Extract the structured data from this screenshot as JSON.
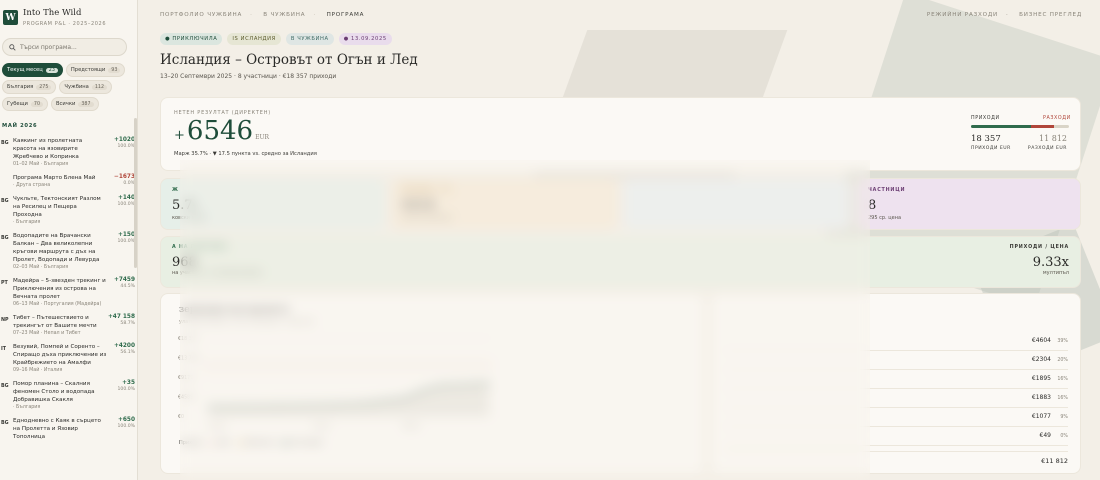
{
  "sidebar": {
    "brand_letter": "W",
    "brand_title": "Into The Wild",
    "brand_sub": "PROGRAM P&L · 2025–2026",
    "search_placeholder": "Търси програма...",
    "filters": [
      {
        "label": "Текущ месец",
        "count": "23",
        "active": true
      },
      {
        "label": "Предстоящи",
        "count": "93",
        "active": false
      },
      {
        "label": "България",
        "count": "275",
        "active": false
      },
      {
        "label": "Чужбина",
        "count": "112",
        "active": false
      },
      {
        "label": "Губещи",
        "count": "70",
        "active": false
      },
      {
        "label": "Всички",
        "count": "387",
        "active": false
      }
    ],
    "month": "МАЙ 2026",
    "programs": [
      {
        "code": "BG",
        "name": "Каякинг из пролетната красота на язовирите Жребчево и Копринка",
        "meta": "01–02 Май · България",
        "net": "+1020",
        "pct": "100.0%",
        "neg": false
      },
      {
        "code": "",
        "name": "Програма Марто Блена Май",
        "meta": "· Друга страна",
        "net": "−1673",
        "pct": "0.0%",
        "neg": true
      },
      {
        "code": "BG",
        "name": "Чукльте, Тектонският Разлом на Ресилец и Пещера Проходна",
        "meta": "· България",
        "net": "+140",
        "pct": "100.0%",
        "neg": false
      },
      {
        "code": "BG",
        "name": "Водопадите на Врачански Балкан – Два великолепни кръгови маршрута с дъх на Пролет, Водопади и Левурда",
        "meta": "02–03 Май · България",
        "net": "+150",
        "pct": "100.0%",
        "neg": false
      },
      {
        "code": "PT",
        "name": "Мадейра – 5-звезден трекинг и Приключения из острова на Вечната пролет",
        "meta": "06–13 Май · Португалия (Мадейра)",
        "net": "+7459",
        "pct": "44.5%",
        "neg": false
      },
      {
        "code": "NP",
        "name": "Тибет – Пътешествието и трекингът от Вашите мечти",
        "meta": "07–23 Май · Непал и Тибет",
        "net": "+47 158",
        "pct": "58.7%",
        "neg": false
      },
      {
        "code": "IT",
        "name": "Везувий, Помпей и Соренто – Спиращо дъха приключение из Крайбрежието на Амалфи",
        "meta": "09–16 Май · Италия",
        "net": "+4200",
        "pct": "56.1%",
        "neg": false
      },
      {
        "code": "BG",
        "name": "Помор планина – Скалния феномен Столо и водопада Добравишка Скакля",
        "meta": "· България",
        "net": "+35",
        "pct": "100.0%",
        "neg": false
      },
      {
        "code": "BG",
        "name": "Еднодневно с Каяк в сърцето на Пролетта и Язовир Тополница",
        "meta": "",
        "net": "+650",
        "pct": "100.0%",
        "neg": false
      }
    ]
  },
  "header": {
    "crumbs": [
      "ПОРТФОЛИО ЧУЖБИНА",
      "В ЧУЖБИНА",
      "ПРОГРАМА"
    ],
    "links": [
      "РЕЖИЙНИ РАЗХОДИ",
      "БИЗНЕС ПРЕГЛЕД"
    ],
    "tags": [
      "ПРИКЛЮЧИЛА",
      "IS ИСЛАНДИЯ",
      "В ЧУЖБИНА",
      "13.09.2025"
    ],
    "title": "Исландия – Островът от Огън и Лед",
    "subtitle": "13–20 Септември 2025 · 8 участници · €18 357 приходи"
  },
  "net": {
    "label": "НЕТЕН РЕЗУЛТАТ (ДИРЕКТЕН)",
    "sign": "+",
    "value": "6546",
    "currency": "EUR",
    "margin": "Марж 35.7% · ▼ 17.5 пункта vs. средно за Исландия",
    "rev_label": "ПРИХОДИ",
    "exp_label": "РАЗХОДИ",
    "rev_value": "18 357",
    "exp_value": "11 812",
    "rev_sub": "ПРИХОДИ EUR",
    "exp_sub": "РАЗХОДИ EUR",
    "rev_share": 0.61,
    "colors": {
      "revenue": "#2f6b4c",
      "expenses": "#b0463a"
    }
  },
  "kpis": [
    {
      "label": "Ж",
      "value": "5.7",
      "unit": "%",
      "sub": "ковски марж"
    },
    {
      "label": "ПЕЧАЛБА / УЧ.",
      "value": "€818",
      "unit": "",
      "sub": "нетно на участник"
    },
    {
      "label": "",
      "value": "",
      "unit": "",
      "sub": ""
    },
    {
      "label": "ЧАСТНИЦИ",
      "value": "8",
      "unit": "",
      "sub": "295 ср. цена"
    }
  ],
  "wide": {
    "label": "А НА ПРОГРАМА",
    "value": "968",
    "sub": "на участник · от participant файла",
    "r_label": "ПРИХОДИ / ЦЕНА",
    "r_value": "9.33x",
    "r_sub": "мултипъл"
  },
  "chart": {
    "title": "зервации във времето",
    "subtitle": "улативни приходи · праг на разходите · break-even",
    "legend": [
      "Приходи",
      "Праг",
      "Break-even",
      "Отпътуване"
    ]
  },
  "chart_data": {
    "type": "line",
    "title": "зервации във времето",
    "xlabel": "",
    "ylabel": "",
    "x_ticks": [
      "10.04 г.",
      "12.04 г.",
      "08.29 г."
    ],
    "y_ticks": [
      "€18 357",
      "€13 768",
      "€9179",
      "€4589",
      "€0"
    ],
    "ylim": [
      0,
      18357
    ],
    "series": [
      {
        "name": "Приходи",
        "values": [
          2100,
          2300,
          2600,
          2900,
          3300,
          3700,
          4100,
          5300,
          6300,
          7100,
          7200,
          7400,
          7700
        ]
      },
      {
        "name": "Праг",
        "values": [
          11812,
          11812,
          11812,
          11812,
          11812,
          11812,
          11812,
          11812,
          11812,
          11812,
          11812,
          11812,
          11812
        ]
      }
    ]
  },
  "expenses": {
    "rows": [
      {
        "value": "€4604",
        "pct": "39%"
      },
      {
        "value": "€2304",
        "pct": "20%"
      },
      {
        "value": "€1895",
        "pct": "16%"
      },
      {
        "value": "€1883",
        "pct": "16%"
      },
      {
        "value": "€1077",
        "pct": "9%"
      },
      {
        "value": "€49",
        "pct": "0%"
      }
    ],
    "total": "€11 812"
  }
}
